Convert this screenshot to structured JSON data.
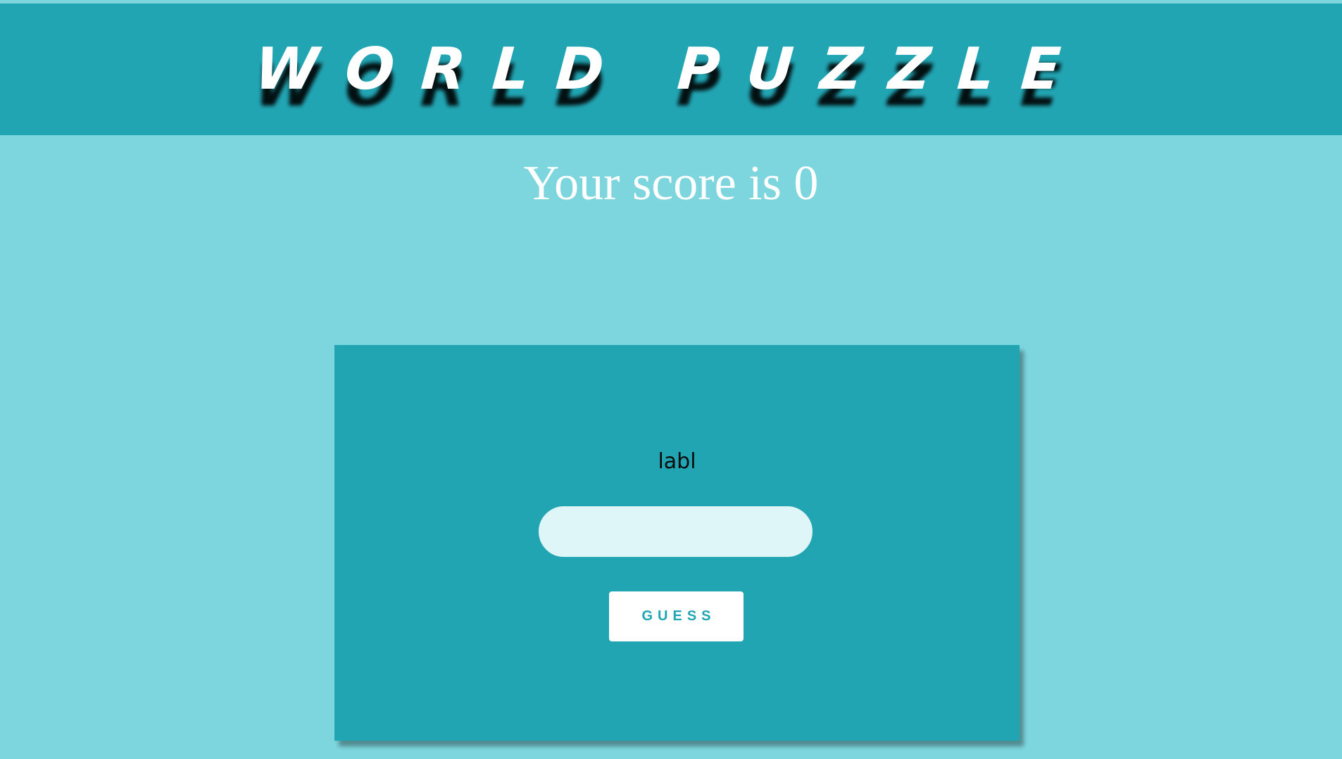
{
  "header": {
    "title": "WORLD PUZZLE"
  },
  "score": {
    "text": "Your score is 0"
  },
  "game": {
    "label": "labl",
    "input_value": "",
    "guess_button_label": "GUESS"
  },
  "colors": {
    "background": "#7dd6de",
    "header": "#22a5b3",
    "card": "#22a5b3",
    "input": "#dff6f8",
    "button": "#ffffff",
    "button_text": "#22a5b3"
  }
}
